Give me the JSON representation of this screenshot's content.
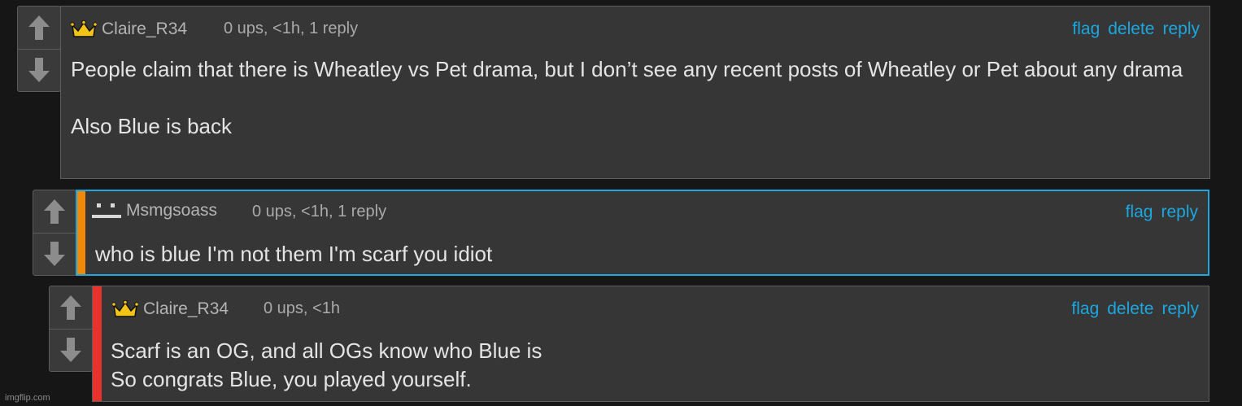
{
  "comments": [
    {
      "username": "Claire_R34",
      "avatar_icon": "crown-icon",
      "meta": "0 ups, <1h, 1 reply",
      "actions": [
        "flag",
        "delete",
        "reply"
      ],
      "text": "People claim that there is Wheatley vs Pet drama, but I don’t see any recent posts of Wheatley or Pet about any drama\n\nAlso Blue is back"
    },
    {
      "username": "Msmgsoass",
      "avatar_icon": "face-icon",
      "meta": "0 ups, <1h, 1 reply",
      "actions": [
        "flag",
        "reply"
      ],
      "text": "who is blue I'm not them I'm scarf you idiot",
      "accent_color": "#f0880a",
      "highlight_color": "#1ba7e0"
    },
    {
      "username": "Claire_R34",
      "avatar_icon": "crown-icon",
      "meta": "0 ups, <1h",
      "actions": [
        "flag",
        "delete",
        "reply"
      ],
      "text": "Scarf is an OG, and all OGs know who Blue is\nSo congrats Blue, you played yourself.",
      "accent_color": "#e8322e"
    }
  ],
  "colors": {
    "link": "#1ba7e0",
    "background": "#161616",
    "panel": "#363636"
  },
  "watermark": "imgflip.com"
}
